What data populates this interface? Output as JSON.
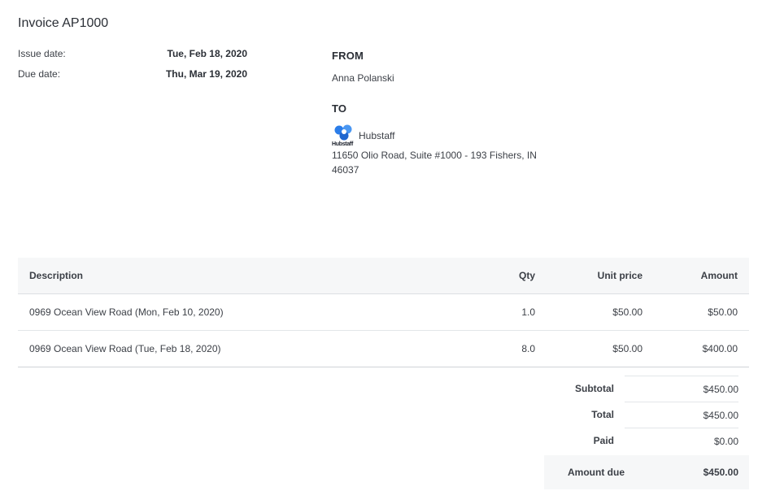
{
  "invoice": {
    "title": "Invoice AP1000",
    "issue_label": "Issue date:",
    "issue_value": "Tue, Feb 18, 2020",
    "due_label": "Due date:",
    "due_value": "Thu, Mar 19, 2020"
  },
  "from": {
    "heading": "FROM",
    "name": "Anna Polanski"
  },
  "to": {
    "heading": "TO",
    "logo_icon": "hubstaff-logo-icon",
    "logo_caption": "Hubstaff",
    "company": "Hubstaff",
    "address": "11650 Olio Road, Suite #1000 - 193 Fishers, IN 46037"
  },
  "table": {
    "headers": {
      "description": "Description",
      "qty": "Qty",
      "unit_price": "Unit price",
      "amount": "Amount"
    },
    "rows": [
      {
        "description": "0969 Ocean View Road (Mon, Feb 10, 2020)",
        "qty": "1.0",
        "unit_price": "$50.00",
        "amount": "$50.00"
      },
      {
        "description": "0969 Ocean View Road (Tue, Feb 18, 2020)",
        "qty": "8.0",
        "unit_price": "$50.00",
        "amount": "$400.00"
      }
    ]
  },
  "totals": {
    "subtotal_label": "Subtotal",
    "subtotal_value": "$450.00",
    "total_label": "Total",
    "total_value": "$450.00",
    "paid_label": "Paid",
    "paid_value": "$0.00",
    "due_label": "Amount due",
    "due_value": "$450.00"
  },
  "colors": {
    "logo_blue": "#2b7de9",
    "header_bg": "#f6f7f8"
  }
}
